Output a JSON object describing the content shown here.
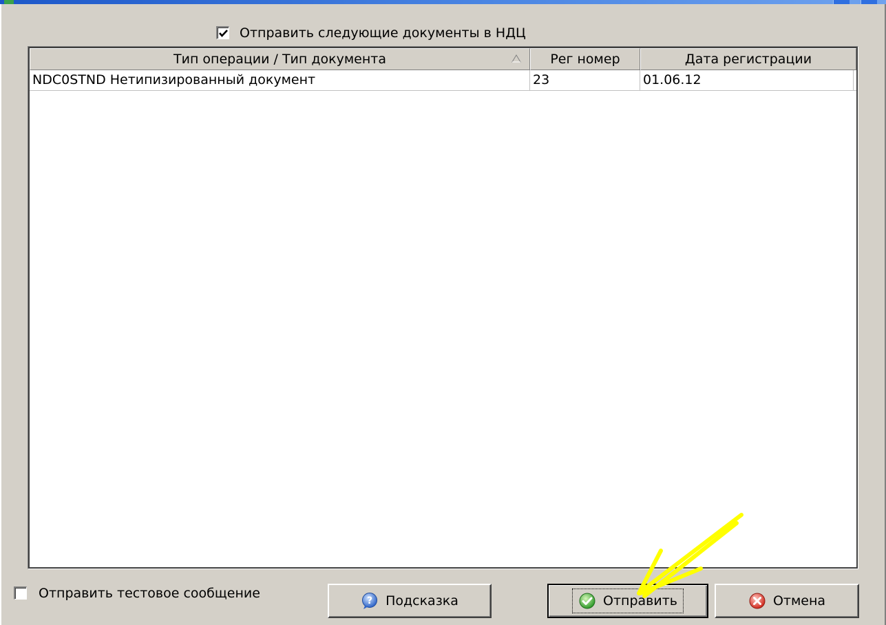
{
  "window": {
    "accent_color": "#1c57c9",
    "background_color": "#d4d0c8"
  },
  "send_documents_checkbox": {
    "label": "Отправить следующие документы в НДЦ",
    "checked": true
  },
  "documents_table": {
    "columns": [
      {
        "label": "Тип операции / Тип документа",
        "sort": "ascending"
      },
      {
        "label": "Рег номер"
      },
      {
        "label": "Дата регистрации"
      }
    ],
    "rows": [
      {
        "type": "NDC0STND Нетипизированный документ",
        "reg_number": "23",
        "reg_date": "01.06.12"
      }
    ]
  },
  "test_message_checkbox": {
    "label": "Отправить тестовое сообщение",
    "checked": false
  },
  "buttons": {
    "help": {
      "label": "Подсказка",
      "icon": "question-icon"
    },
    "send": {
      "label": "Отправить",
      "icon": "check-icon"
    },
    "cancel": {
      "label": "Отмена",
      "icon": "cancel-icon"
    }
  },
  "annotation": {
    "type": "arrow",
    "color": "#ffff00",
    "points_to": "send-button"
  }
}
